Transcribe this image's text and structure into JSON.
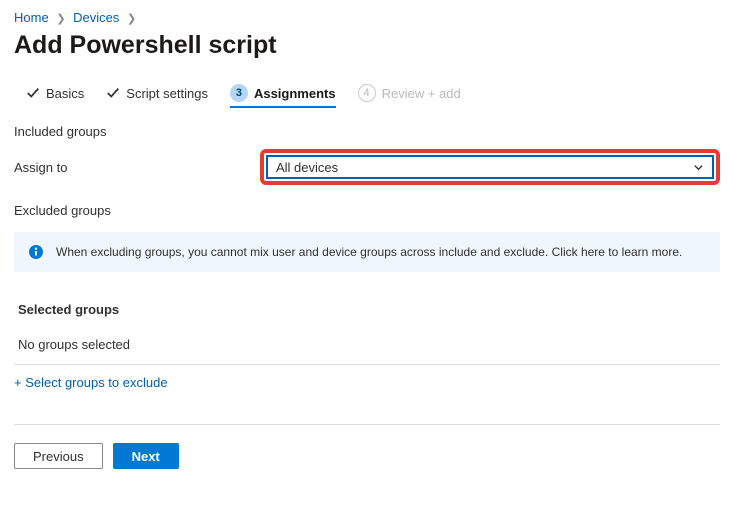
{
  "breadcrumb": [
    {
      "label": "Home"
    },
    {
      "label": "Devices"
    }
  ],
  "page_title": "Add Powershell script",
  "tabs": [
    {
      "label": "Basics",
      "state": "done"
    },
    {
      "label": "Script settings",
      "state": "done"
    },
    {
      "num": "3",
      "label": "Assignments",
      "state": "active"
    },
    {
      "num": "4",
      "label": "Review + add",
      "state": "disabled"
    }
  ],
  "included_heading": "Included groups",
  "assign_to_label": "Assign to",
  "assign_to_value": "All devices",
  "excluded_heading": "Excluded groups",
  "info_text": "When excluding groups, you cannot mix user and device groups across include and exclude. Click here to learn more.",
  "selected_groups_heading": "Selected groups",
  "selected_groups_empty": "No groups selected",
  "add_exclude_link": "+ Select groups to exclude",
  "buttons": {
    "previous": "Previous",
    "next": "Next"
  }
}
